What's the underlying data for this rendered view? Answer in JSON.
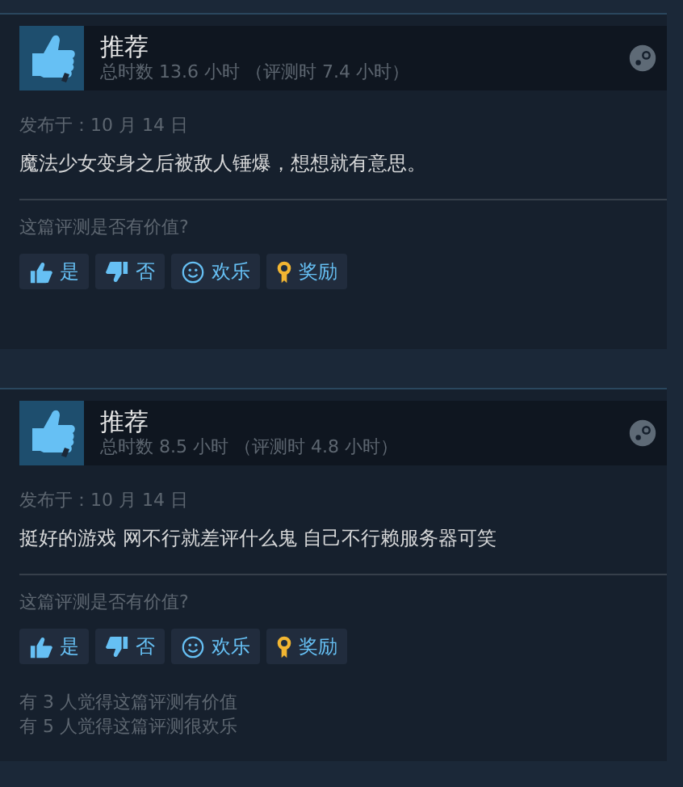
{
  "reviews": [
    {
      "recommended": true,
      "title": "推荐",
      "hours": "总时数 13.6 小时 （评测时 7.4 小时）",
      "date": "发布于：10 月 14 日",
      "text": "魔法少女变身之后被敌人锤爆，想想就有意思。",
      "question": "这篇评测是否有价值?",
      "buttons": [
        {
          "kind": "yes",
          "label": "是"
        },
        {
          "kind": "no",
          "label": "否"
        },
        {
          "kind": "funny",
          "label": "欢乐"
        },
        {
          "kind": "award",
          "label": "奖励"
        }
      ]
    },
    {
      "recommended": true,
      "title": "推荐",
      "hours": "总时数 8.5 小时 （评测时 4.8 小时）",
      "date": "发布于：10 月 14 日",
      "text": "挺好的游戏 网不行就差评什么鬼 自己不行赖服务器可笑",
      "question": "这篇评测是否有价值?",
      "buttons": [
        {
          "kind": "yes",
          "label": "是"
        },
        {
          "kind": "no",
          "label": "否"
        },
        {
          "kind": "funny",
          "label": "欢乐"
        },
        {
          "kind": "award",
          "label": "奖励"
        }
      ],
      "stats": [
        "有 3 人觉得这篇评测有价值",
        "有 5 人觉得这篇评测很欢乐"
      ]
    }
  ]
}
